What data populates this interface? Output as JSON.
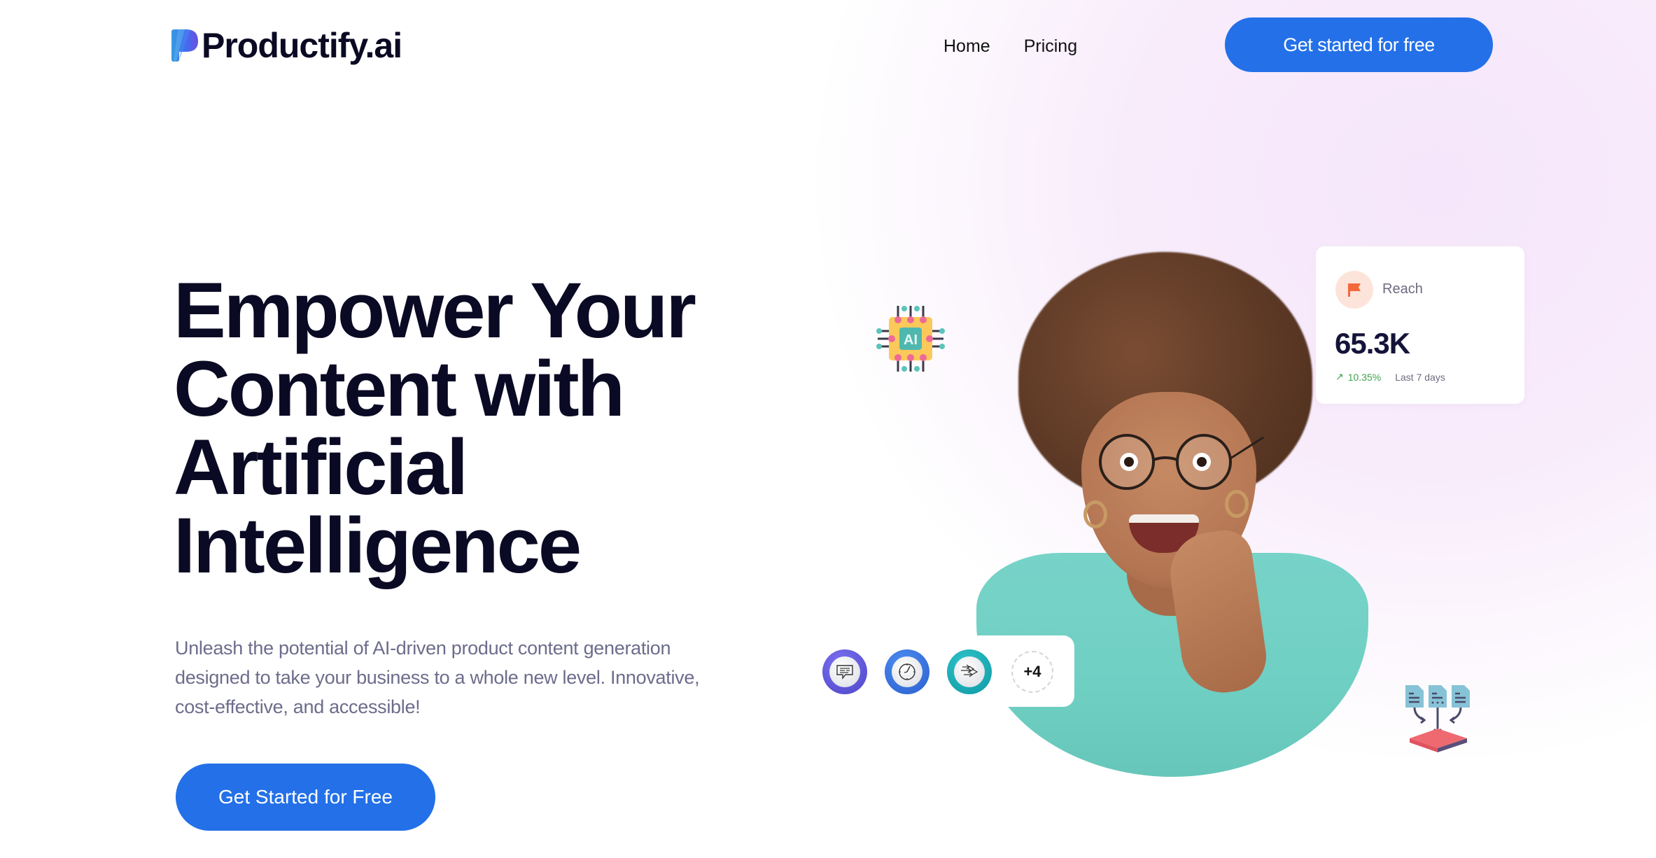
{
  "brand": {
    "name": "Productify.ai",
    "colors": {
      "primary": "#2370e8",
      "heading": "#0b0a24",
      "body_text": "#6c6c8c",
      "trend_up": "#3fa34d",
      "reach_icon": "#f26a3b"
    }
  },
  "nav": {
    "links": [
      {
        "label": "Home"
      },
      {
        "label": "Pricing"
      }
    ],
    "cta_label": "Get started for free"
  },
  "hero": {
    "title_lines": [
      "Empower Your",
      "Content with",
      "Artificial",
      "Intelligence"
    ],
    "subtitle": "Unleash the potential of AI-driven product content generation designed to take your business to a whole new level. Innovative, cost-effective, and accessible!",
    "cta_label": "Get Started for Free"
  },
  "reach_card": {
    "icon": "flag-icon",
    "label": "Reach",
    "value": "65.3K",
    "trend_icon": "arrow-up-right-icon",
    "trend_arrow": "↗",
    "trend_percent": "10.35%",
    "trend_period": "Last 7 days"
  },
  "tools_card": {
    "tools": [
      {
        "icon": "chat-message-icon",
        "ring_color": "#5b52d6"
      },
      {
        "icon": "clock-icon",
        "ring_color": "#2e6fdc"
      },
      {
        "icon": "fast-forward-arrows-icon",
        "ring_color": "#14a8b4"
      }
    ],
    "more_label": "+4"
  },
  "decorations": {
    "chip_icon": "ai-chip-icon",
    "chip_label": "AI",
    "docs_icon": "documents-merge-icon"
  }
}
